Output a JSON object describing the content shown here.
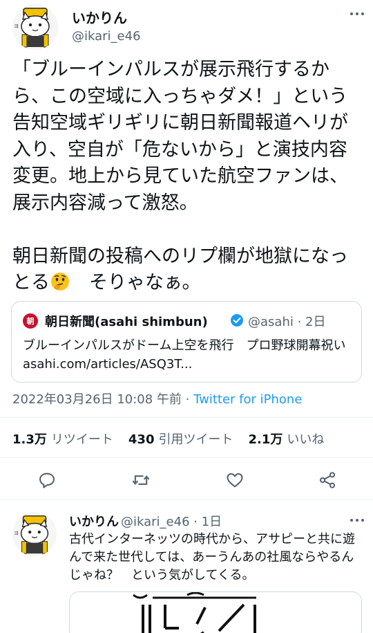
{
  "tweet": {
    "author_name": "いかりん",
    "author_handle": "@ikari_e46",
    "text": "「ブルーインパルスが展示飛行するから、この空域に入っちゃダメ！」という告知空域ギリギリに朝日新聞報道ヘリが入り、空自が「危ないから」と演技内容変更。地上から見ていた航空ファンは、展示内容減って激怒。\n\n朝日新聞の投稿へのリプ欄が地獄になっとる",
    "text_tail": "　そりゃなぁ。",
    "emoji": "thinking-face",
    "timestamp": "2022年03月26日 10:08 午前 · ",
    "source": "Twitter for iPhone"
  },
  "quote": {
    "logo_char": "朝",
    "name": "朝日新聞(asahi shimbun)",
    "meta": "@asahi · 2日",
    "text": "ブルーインパルスがドーム上空を飛行　プロ野球開幕祝い asahi.com/articles/ASQ3T..."
  },
  "stats": {
    "retweets_count": "1.3万",
    "retweets_label": "リツイート",
    "quotes_count": "430",
    "quotes_label": "引用ツイート",
    "likes_count": "2.1万",
    "likes_label": "いいね"
  },
  "reply": {
    "author_name": "いかりん",
    "meta": "@ikari_e46 · 1日",
    "text": "古代インターネッツの時代から、アサピーと共に遊んで来た世代しては、あーうんあの社風ならやるんじゃね？　という気がしてくる。"
  },
  "colors": {
    "accent": "#1d9bf0",
    "secondary_text": "#536471",
    "border": "#cfd9de",
    "asahi_red": "#c8102e"
  }
}
